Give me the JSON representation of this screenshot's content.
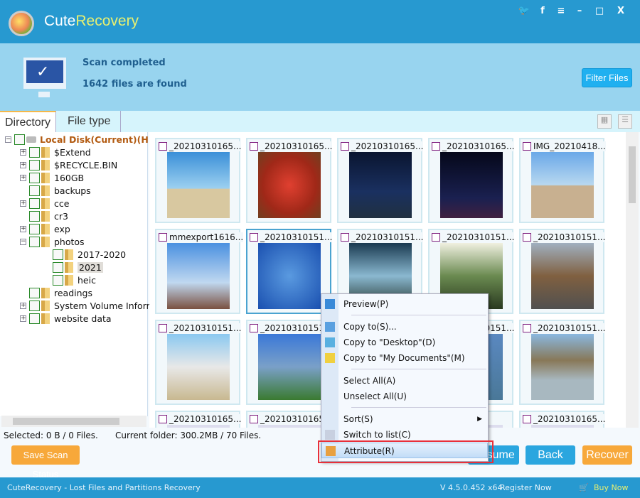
{
  "app": {
    "title_part1": "Cute",
    "title_part2": "Recovery"
  },
  "window_buttons": [
    {
      "name": "twitter-icon",
      "glyph": "🐦"
    },
    {
      "name": "facebook-icon",
      "glyph": "f"
    },
    {
      "name": "menu-icon",
      "glyph": "≡"
    },
    {
      "name": "minimize-icon",
      "glyph": "–"
    },
    {
      "name": "maximize-icon",
      "glyph": "□"
    },
    {
      "name": "close-icon",
      "glyph": "X"
    }
  ],
  "banner": {
    "title": "Scan completed",
    "count": "1642 files are found",
    "filter_label": "Filter Files"
  },
  "tabs": [
    "Directory",
    "File type"
  ],
  "tree": {
    "root": "Local Disk(Current)(H:)",
    "items": [
      "$Extend",
      "$RECYCLE.BIN",
      "160GB",
      "backups",
      "cce",
      "cr3",
      "exp",
      "photos",
      "2017-2020",
      "2021",
      "heic",
      "readings",
      "System Volume Informa",
      "website data"
    ]
  },
  "files": [
    "_20210310165...",
    "_20210310165...",
    "_20210310165...",
    "_20210310165...",
    "IMG_20210418...",
    "mmexport1616...",
    "_20210310151...",
    "_20210310151...",
    "_20210310151...",
    "_20210310151...",
    "_20210310151...",
    "_20210310151...",
    "_20210310151...",
    "_20210310151...",
    "_20210310151...",
    "_20210310165...",
    "_20210310165...",
    "_20210310165...",
    "...424...",
    "_20210310165..."
  ],
  "status": {
    "selected": "Selected: 0 B / 0 Files.",
    "current": "Current folder: 300.2MB / 70 Files."
  },
  "buttons": {
    "save": "Save Scan Status",
    "resume": "Resume",
    "back": "Back",
    "recover": "Recover"
  },
  "context_menu": [
    "Preview(P)",
    "Copy to(S)...",
    "Copy to \"Desktop\"(D)",
    "Copy to \"My Documents\"(M)",
    "Select All(A)",
    "Unselect All(U)",
    "Sort(S)",
    "Switch to list(C)",
    "Attribute(R)"
  ],
  "footer": {
    "left": "CuteRecovery - Lost Files and Partitions Recovery",
    "version": "V 4.5.0.452 x64",
    "register": "Register Now",
    "buy": "Buy Now"
  },
  "colors": {
    "titlebar": "#2799d0",
    "banner": "#98d4ef",
    "orange": "#f7a83a",
    "highlight": "#e8303a"
  }
}
